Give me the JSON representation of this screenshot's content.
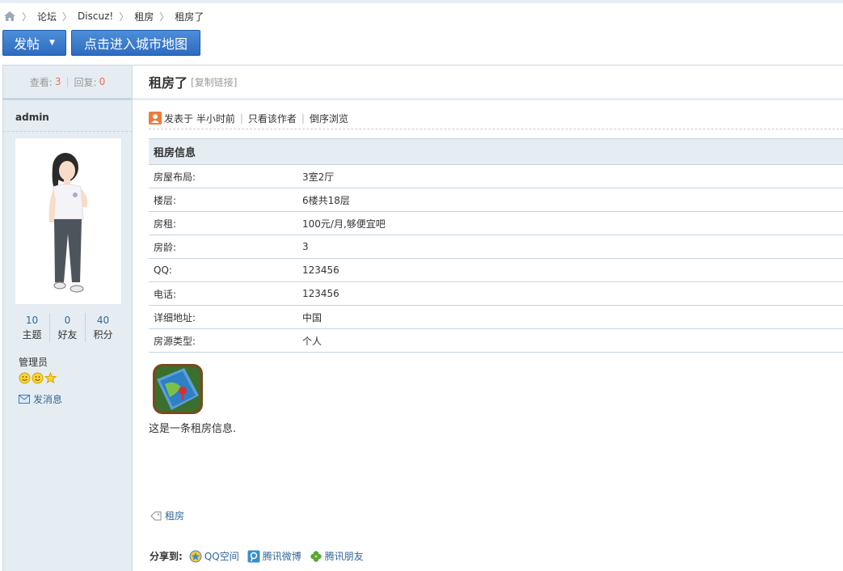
{
  "breadcrumb": {
    "items": [
      "论坛",
      "Discuz!",
      "租房",
      "租房了"
    ]
  },
  "toolbar": {
    "post_label": "发帖",
    "map_label": "点击进入城市地图"
  },
  "sidebar": {
    "views_label": "查看:",
    "views": "3",
    "replies_label": "回复:",
    "replies": "0",
    "username": "admin",
    "stats": [
      {
        "value": "10",
        "label": "主题"
      },
      {
        "value": "0",
        "label": "好友"
      },
      {
        "value": "40",
        "label": "积分"
      }
    ],
    "group": "管理员",
    "send_message": "发消息"
  },
  "thread": {
    "title": "租房了",
    "copy_link": "[复制链接]",
    "posted": "发表于 半小时前",
    "only_author": "只看该作者",
    "reverse": "倒序浏览",
    "info_title": "租房信息",
    "info_rows": [
      {
        "k": "房屋布局:",
        "v": "3室2厅"
      },
      {
        "k": "楼层:",
        "v": "6楼共18层"
      },
      {
        "k": "房租:",
        "v": "100元/月,够便宜吧"
      },
      {
        "k": "房龄:",
        "v": "3"
      },
      {
        "k": "QQ:",
        "v": "123456"
      },
      {
        "k": "电话:",
        "v": "123456"
      },
      {
        "k": "详细地址:",
        "v": "中国"
      },
      {
        "k": "房源类型:",
        "v": "个人"
      }
    ],
    "message": "这是一条租房信息.",
    "tag": "租房",
    "share_label": "分享到:",
    "share_items": [
      "QQ空间",
      "腾讯微博",
      "腾讯朋友"
    ]
  },
  "colors": {
    "accent": "#2d6bbf",
    "link": "#336699",
    "highlight": "#f26c4f",
    "panel": "#e5edf2"
  }
}
